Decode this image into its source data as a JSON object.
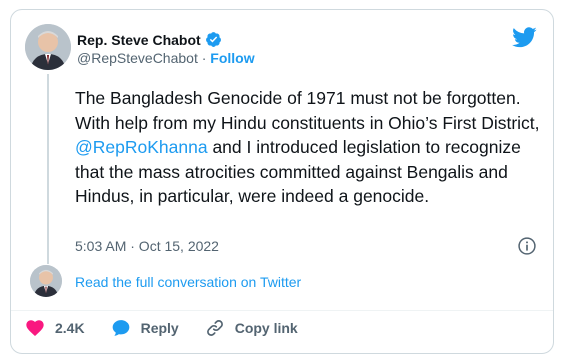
{
  "author": {
    "name": "Rep. Steve Chabot",
    "handle": "@RepSteveChabot",
    "separator": " · ",
    "follow_label": "Follow"
  },
  "tweet": {
    "text_before": "The Bangladesh Genocide of 1971 must not be forgotten. With help from my Hindu constituents in Ohio’s First District, ",
    "mention": "@RepRoKhanna",
    "text_after": " and I introduced legislation to recognize that the mass atrocities committed against Bengalis and Hindus, in particular, were indeed a genocide.",
    "timestamp": "5:03 AM · Oct 15, 2022"
  },
  "conversation": {
    "link_label": "Read the full conversation on Twitter"
  },
  "actions": {
    "like_count": "2.4K",
    "reply_label": "Reply",
    "copy_link_label": "Copy link"
  },
  "colors": {
    "brand": "#1d9bf0",
    "like": "#f91880",
    "muted": "#536471",
    "text": "#0f1419"
  },
  "icons": [
    "verified-badge-icon",
    "twitter-bird-icon",
    "info-icon",
    "heart-icon",
    "reply-bubble-icon",
    "link-icon"
  ]
}
